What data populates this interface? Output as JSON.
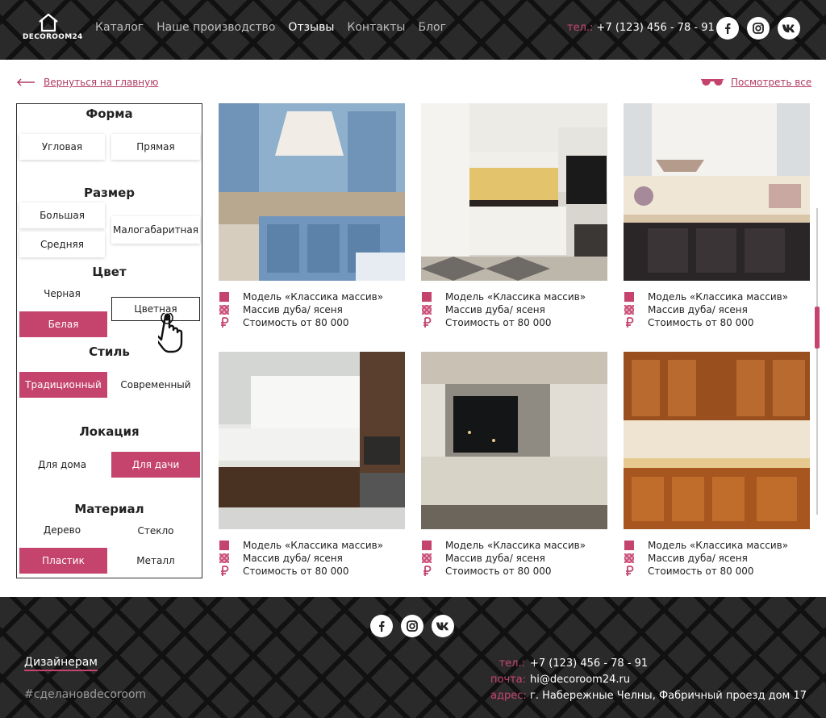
{
  "brand": {
    "logo_text": "DECOROOM24"
  },
  "nav": {
    "items": [
      {
        "label": "Каталог"
      },
      {
        "label": "Наше производство"
      },
      {
        "label": "Отзывы"
      },
      {
        "label": "Контакты"
      },
      {
        "label": "Блог"
      }
    ],
    "active": "Отзывы"
  },
  "header_phone": {
    "label": "тел.:",
    "number": "+7 (123) 456 - 78 - 91"
  },
  "social": [
    "facebook-icon",
    "instagram-icon",
    "vk-icon"
  ],
  "back_link": {
    "label": "Вернуться на главную"
  },
  "view_all": {
    "label": "Посмотреть все"
  },
  "filters": {
    "shape": {
      "title": "Форма",
      "options": [
        "Угловая",
        "Прямая"
      ]
    },
    "size": {
      "title": "Размер",
      "options": [
        "Большая",
        "Малогабаритная",
        "Средняя"
      ]
    },
    "color": {
      "title": "Цвет",
      "options": [
        "Черная",
        "Цветная",
        "Белая"
      ],
      "selected": "Белая",
      "hovered": "Цветная"
    },
    "style": {
      "title": "Стиль",
      "options": [
        "Традиционный",
        "Современный"
      ],
      "selected": "Традиционный"
    },
    "location": {
      "title": "Локация",
      "options": [
        "Для дома",
        "Для дачи"
      ],
      "selected": "Для дачи"
    },
    "material": {
      "title": "Материал",
      "options": [
        "Дерево",
        "Стекло",
        "Пластик",
        "Металл"
      ],
      "selected": "Пластик"
    }
  },
  "products": [
    {
      "model": "Модель  «Классика массив»",
      "material": "Массив дуба/ ясеня",
      "price": "Стоимость от 80 000",
      "photo": "blue classic kitchen"
    },
    {
      "model": "Модель  «Классика массив»",
      "material": "Массив дуба/ ясеня",
      "price": "Стоимость от 80 000",
      "photo": "white classic kitchen"
    },
    {
      "model": "Модель  «Классика массив»",
      "material": "Массив дуба/ ясеня",
      "price": "Стоимость от 80 000",
      "photo": "black gloss kitchen"
    },
    {
      "model": "Модель  «Классика массив»",
      "material": "Массив дуба/ ясеня",
      "price": "Стоимость от 80 000",
      "photo": "white and wood modern kitchen"
    },
    {
      "model": "Модель  «Классика массив»",
      "material": "Массив дуба/ ясеня",
      "price": "Стоимость от 80 000",
      "photo": "white kitchen with night window"
    },
    {
      "model": "Модель  «Классика массив»",
      "material": "Массив дуба/ ясеня",
      "price": "Стоимость от 80 000",
      "photo": "wooden classic kitchen"
    }
  ],
  "footer": {
    "designers_link": "Дизайнерам",
    "hashtag": "#сделановdecoroom",
    "phone_label": "тел.:",
    "phone": "+7 (123) 456 - 78 - 91",
    "email_label": "почта:",
    "email": "hi@decoroom24.ru",
    "address_label": "адрес:",
    "address": "г. Набережные Челны, Фабричный проезд дом 17"
  },
  "colors": {
    "accent": "#c4446d",
    "dark": "#2a2a2a"
  }
}
